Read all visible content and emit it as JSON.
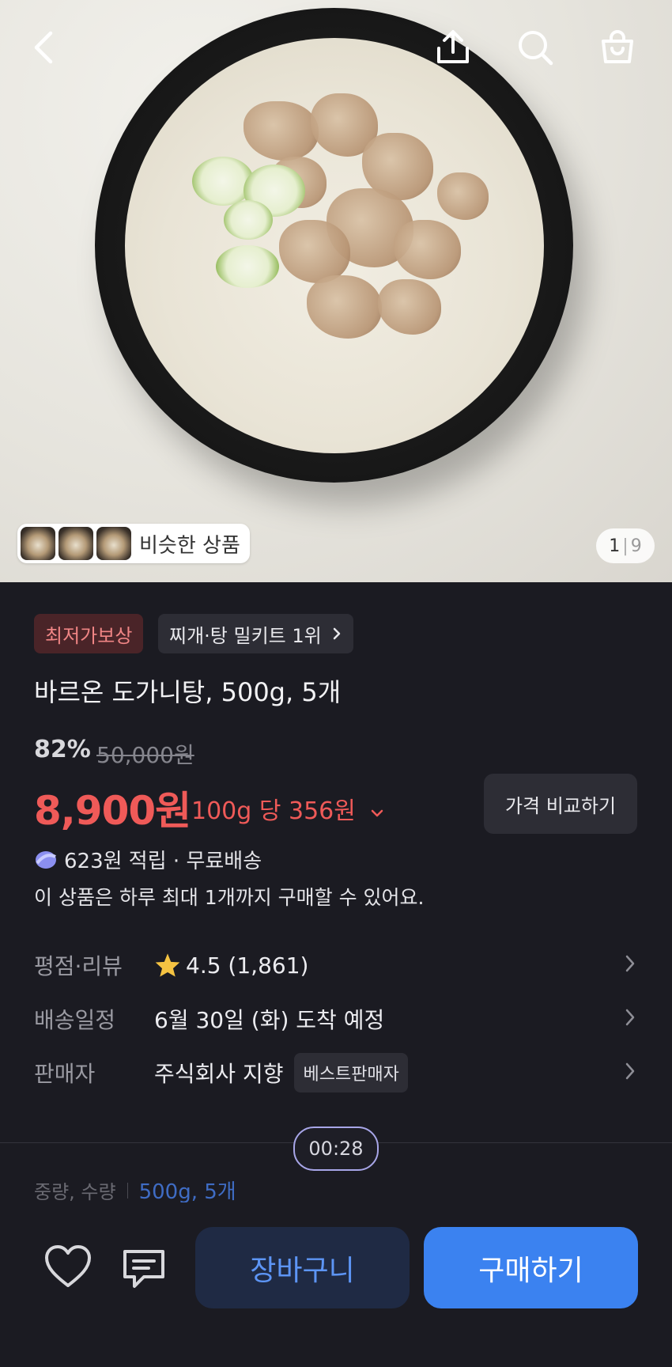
{
  "hero": {
    "similar_label": "비슷한 상품",
    "pager": {
      "current": "1",
      "separator": "|",
      "total": "9"
    }
  },
  "badges": {
    "lowest_price": "최저가보상",
    "rank": "찌개·탕 밀키트 1위"
  },
  "product": {
    "title": "바르온 도가니탕, 500g, 5개",
    "discount": "82%",
    "original_price": "50,000원",
    "price": "8,900원",
    "unit_price": "100g 당 356원",
    "compare_label": "가격 비교하기",
    "points_text": "623원 적립 · 무료배송",
    "purchase_limit": "이 상품은 하루 최대 1개까지 구매할 수 있어요."
  },
  "info_rows": {
    "rating_label": "평점·리뷰",
    "rating_value": "4.5 (1,861)",
    "delivery_label": "배송일정",
    "delivery_value": "6월 30일 (화) 도착 예정",
    "seller_label": "판매자",
    "seller_value": "주식회사 지향",
    "seller_badge": "베스트판매자"
  },
  "timer": "00:28",
  "option": {
    "label": "중량, 수량",
    "value": "500g, 5개"
  },
  "bottom_bar": {
    "cart_label": "장바구니",
    "buy_label": "구매하기"
  },
  "colors": {
    "price_red": "#ef5a58",
    "accent_blue": "#3b82f0",
    "background": "#1b1b22"
  }
}
